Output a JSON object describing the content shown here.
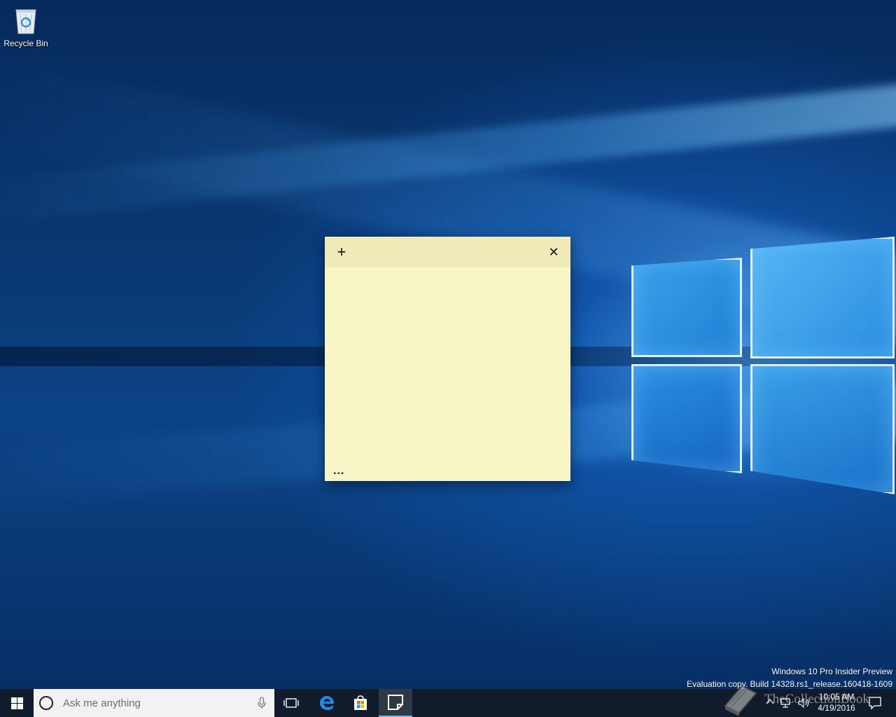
{
  "desktop": {
    "recycle_bin_label": "Recycle Bin"
  },
  "sticky_note": {
    "add_symbol": "+",
    "close_symbol": "✕",
    "menu_symbol": "...",
    "body_text": "",
    "colors": {
      "body": "#f8f5c6",
      "header": "#f0eab8"
    }
  },
  "watermark": {
    "line1": "Windows 10 Pro Insider Preview",
    "line2": "Evaluation copy. Build 14328.rs1_release.160418-1609"
  },
  "taskbar": {
    "search_placeholder": "Ask me anything",
    "pinned": [
      {
        "name": "task-view",
        "icon": "task-view-icon"
      },
      {
        "name": "edge",
        "icon": "edge-icon"
      },
      {
        "name": "store",
        "icon": "store-icon"
      },
      {
        "name": "sticky-notes",
        "icon": "sticky-notes-icon",
        "active": true
      }
    ],
    "clock": {
      "time": "10:05 AM",
      "date": "4/19/2016"
    }
  },
  "overlay": {
    "site_watermark": "TheCollectionBook"
  }
}
